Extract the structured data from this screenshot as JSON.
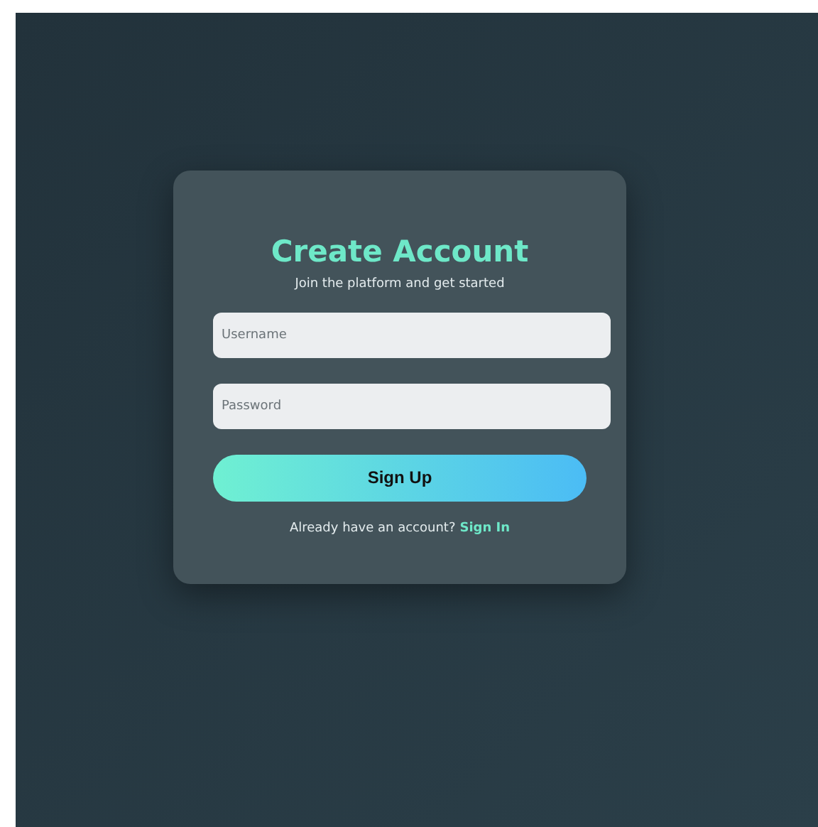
{
  "title": "Create Account",
  "subtitle": "Join the platform and get started",
  "fields": [
    {
      "placeholder": "Username"
    },
    {
      "placeholder": "Password"
    }
  ],
  "submit": "Sign Up",
  "footer": {
    "text": "Already have an account?",
    "link": "Sign In"
  }
}
